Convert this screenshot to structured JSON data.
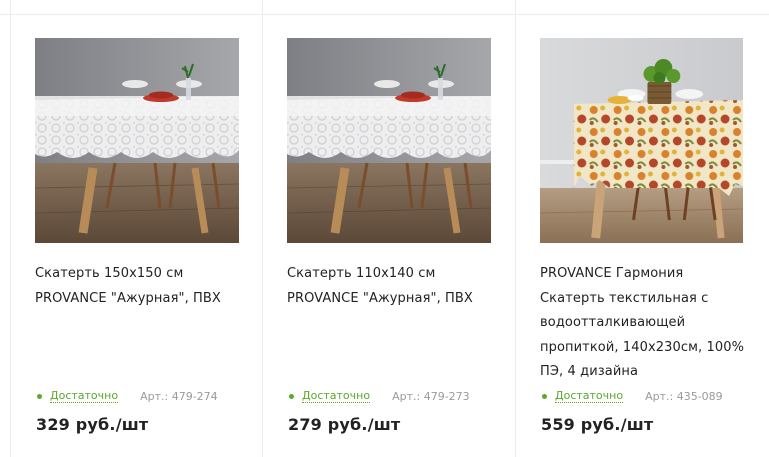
{
  "products": [
    {
      "title_lines": [
        "Скатерть 150х150 см",
        "PROVANCE \"Ажурная\", ПВХ"
      ],
      "stock": "Достаточно",
      "article": "Арт.: 479-274",
      "price": "329 руб./шт",
      "image": "white-lace-tablecloth-photo"
    },
    {
      "title_lines": [
        "Скатерть 110х140 см",
        "PROVANCE \"Ажурная\", ПВХ"
      ],
      "stock": "Достаточно",
      "article": "Арт.: 479-273",
      "price": "279 руб./шт",
      "image": "white-lace-tablecloth-photo"
    },
    {
      "title_lines": [
        "PROVANCE Гармония",
        "Скатерть текстильная с",
        "водоотталкивающей",
        "пропиткой, 140х230см, 100%",
        "ПЭ, 4 дизайна"
      ],
      "stock": "Достаточно",
      "article": "Арт.: 435-089",
      "price": "559 руб./шт",
      "image": "floral-tablecloth-photo"
    }
  ],
  "colors": {
    "stock_green": "#5aa82c",
    "article_gray": "#9a9a9a",
    "border": "#ececec"
  }
}
